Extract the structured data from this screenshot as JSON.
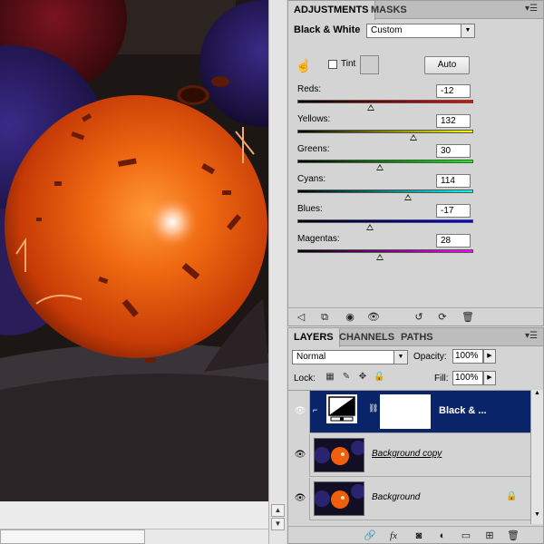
{
  "adjustments_panel": {
    "tabs": [
      {
        "label": "ADJUSTMENTS"
      },
      {
        "label": "MASKS"
      }
    ],
    "menu_icon": "panel-menu-icon",
    "title": "Black & White",
    "preset": "Custom",
    "tint_label": "Tint",
    "tint_checked": false,
    "auto_label": "Auto",
    "sliders": [
      {
        "label": "Reds:",
        "value": "-12",
        "gradient": [
          "#000000",
          "#ff0000"
        ],
        "level": 0.42
      },
      {
        "label": "Yellows:",
        "value": "132",
        "gradient": [
          "#000000",
          "#ffff00"
        ],
        "level": 0.66
      },
      {
        "label": "Greens:",
        "value": "30",
        "gradient": [
          "#000000",
          "#00ff00"
        ],
        "level": 0.47
      },
      {
        "label": "Cyans:",
        "value": "114",
        "gradient": [
          "#000000",
          "#00ffff"
        ],
        "level": 0.63
      },
      {
        "label": "Blues:",
        "value": "-17",
        "gradient": [
          "#000000",
          "#0000ff"
        ],
        "level": 0.41
      },
      {
        "label": "Magentas:",
        "value": "28",
        "gradient": [
          "#000000",
          "#ff00ff"
        ],
        "level": 0.47
      }
    ],
    "footer_icons": [
      "back-icon",
      "clip-to-layer-icon",
      "visibility-toggle-icon",
      "view-previous-icon",
      "reset-icon",
      "refresh-icon",
      "trash-icon"
    ]
  },
  "layers_panel": {
    "tabs": [
      {
        "label": "LAYERS"
      },
      {
        "label": "CHANNELS"
      },
      {
        "label": "PATHS"
      }
    ],
    "blend_mode": "Normal",
    "opacity_label": "Opacity:",
    "opacity": "100%",
    "lock_label": "Lock:",
    "fill_label": "Fill:",
    "fill": "100%",
    "layers": [
      {
        "name": "Black & ...",
        "selected": true
      },
      {
        "name": "Background copy",
        "selected": false
      },
      {
        "name": "Background",
        "selected": false
      }
    ],
    "footer_icons": [
      "link-icon",
      "fx-icon",
      "add-mask-icon",
      "adjustment-layer-icon",
      "group-icon",
      "new-layer-icon",
      "trash-icon"
    ]
  },
  "colors": {
    "selected_layer": "#0a246a",
    "ball_orange": "#f05a0a"
  }
}
